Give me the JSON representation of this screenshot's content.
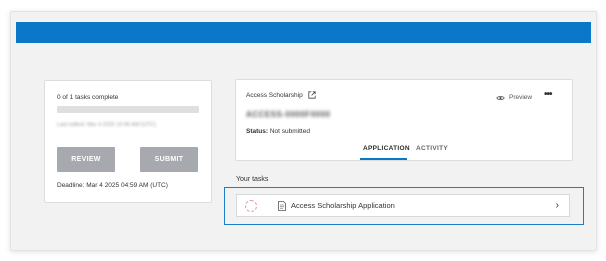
{
  "left_card": {
    "tasks_count": "0 of 1 tasks complete",
    "blurred_note": "Last edited: Mar 4 2025 10:45 AM (UTC)",
    "review_label": "REVIEW",
    "submit_label": "SUBMIT",
    "deadline": "Deadline: Mar 4 2025 04:59 AM (UTC)"
  },
  "right_card": {
    "title": "Access Scholarship",
    "blurred_id": "ACCESS-0000F0000",
    "status_label": "Status:",
    "status_value": "Not submitted",
    "preview_label": "Preview",
    "more_label": "•••",
    "tabs": [
      {
        "label": "APPLICATION",
        "active": true
      },
      {
        "label": "ACTIVITY",
        "active": false
      }
    ]
  },
  "tasks": {
    "heading": "Your tasks",
    "items": [
      {
        "label": "Access Scholarship Application",
        "chevron": "›"
      }
    ]
  },
  "colors": {
    "topbar": "#0a78c6",
    "button_gray": "#a6a9ae",
    "highlight_border": "#1f7dc3"
  }
}
